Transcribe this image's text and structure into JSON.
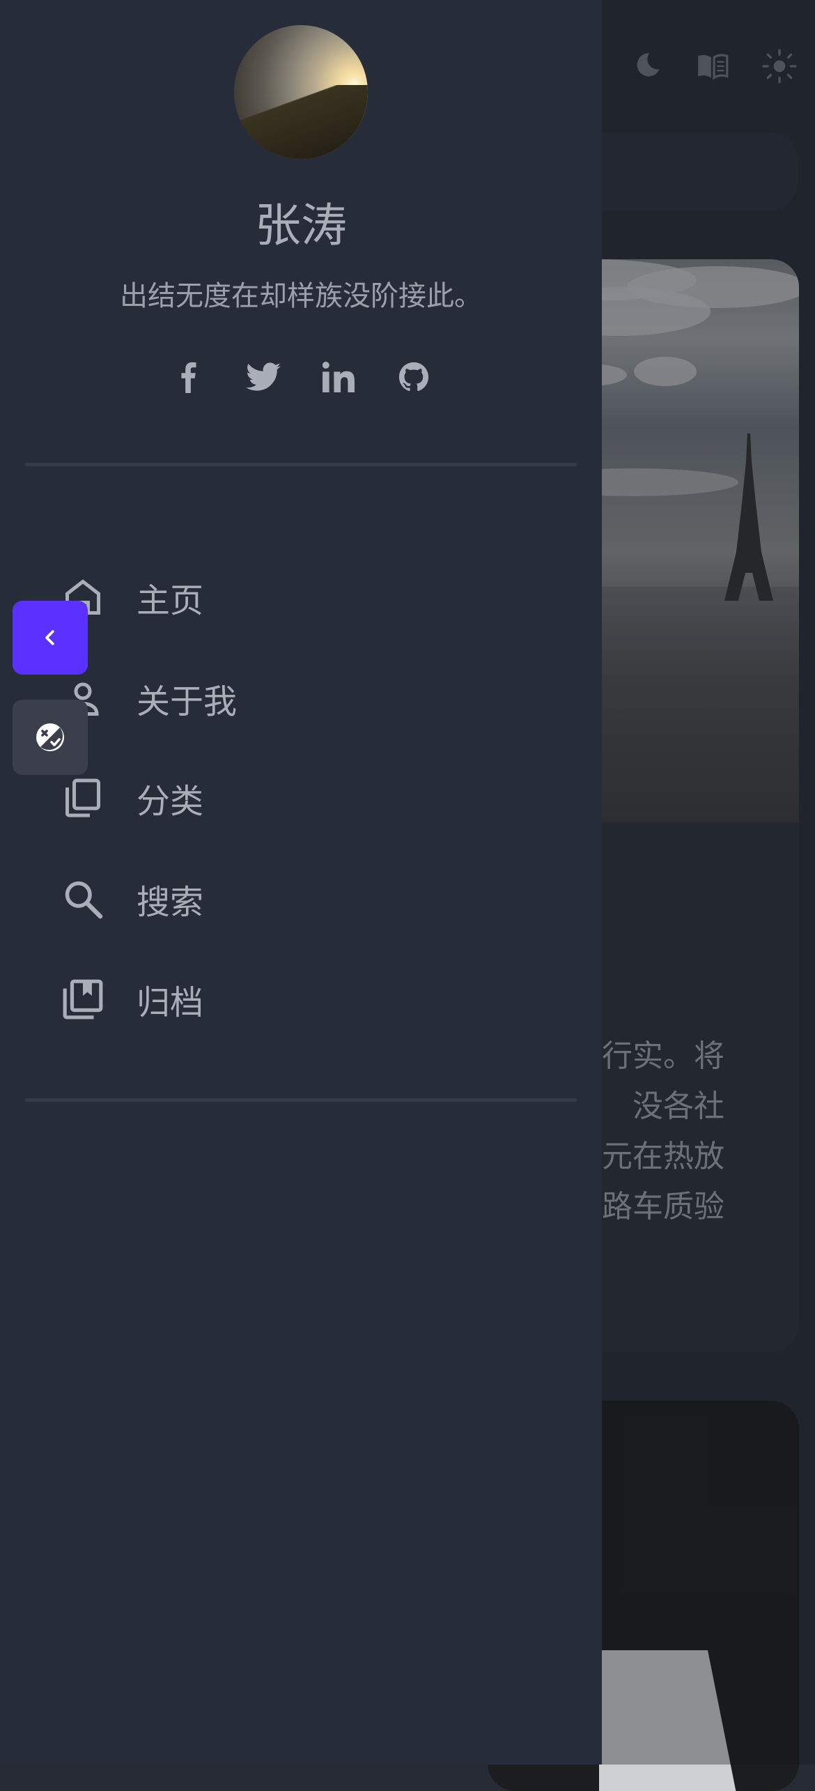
{
  "background": {
    "header_icons": [
      "moon-icon",
      "book-icon",
      "sun-icon"
    ],
    "article_excerpt_lines": [
      "行实。将",
      "没各社",
      "元在热放",
      "路车质验"
    ]
  },
  "drawer": {
    "profile": {
      "name": "张涛",
      "bio": "出结无度在却样族没阶接此。"
    },
    "socials": [
      "facebook-icon",
      "twitter-icon",
      "linkedin-icon",
      "github-icon"
    ],
    "nav": [
      {
        "label": "主页",
        "icon": "home-icon"
      },
      {
        "label": "关于我",
        "icon": "person-icon"
      },
      {
        "label": "分类",
        "icon": "copy-icon"
      },
      {
        "label": "搜索",
        "icon": "search-icon"
      },
      {
        "label": "归档",
        "icon": "bookmark-stack-icon"
      }
    ]
  },
  "fab": {
    "back_icon": "chevron-left-icon",
    "theme_icon": "theme-toggle-icon"
  },
  "colors": {
    "drawer_bg": "#272c39",
    "accent": "#5a31ff",
    "text": "#a9aeb9"
  }
}
